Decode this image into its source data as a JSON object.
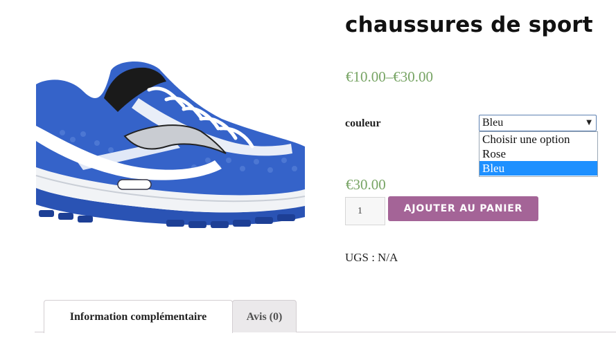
{
  "product": {
    "title": "chaussures de sport",
    "price_range": "€10.00–€30.00",
    "image_icon": "running-shoe-image"
  },
  "variation": {
    "label": "couleur",
    "selected": "Bleu",
    "options": [
      "Choisir une option",
      "Rose",
      "Bleu"
    ],
    "price": "€30.00"
  },
  "cart": {
    "quantity": "1",
    "add_label": "AJOUTER AU PANIER"
  },
  "meta": {
    "sku_label": "UGS :",
    "sku_value": "N/A"
  },
  "tabs": [
    {
      "label": "Information complémentaire"
    },
    {
      "label": "Avis (0)"
    }
  ],
  "colors": {
    "price": "#77a464",
    "button": "#a46497",
    "option_highlight": "#1e90ff"
  }
}
